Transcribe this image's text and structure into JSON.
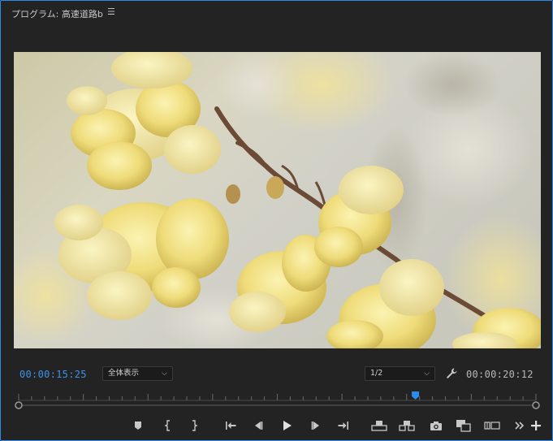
{
  "panel": {
    "title": "プログラム: 高速道路b",
    "menu_icon": "hamburger-menu-icon"
  },
  "playback": {
    "current_time": "00:00:15:25",
    "zoom_select": "全体表示",
    "resolution_select": "1/2",
    "duration": "00:00:20:12",
    "playhead_fraction": 0.767
  },
  "transport_icons": [
    "add-marker-icon",
    "mark-in-icon",
    "mark-out-icon",
    "go-to-in-icon",
    "step-back-icon",
    "play-icon",
    "step-forward-icon",
    "go-to-out-icon",
    "lift-icon",
    "extract-icon",
    "export-frame-icon",
    "comparison-view-icon",
    "vr-video-icon",
    "more-controls-icon",
    "add-button-icon"
  ],
  "colors": {
    "accent": "#2d8ceb",
    "timecode_current": "#3d93e8",
    "panel_bg": "#232323"
  }
}
